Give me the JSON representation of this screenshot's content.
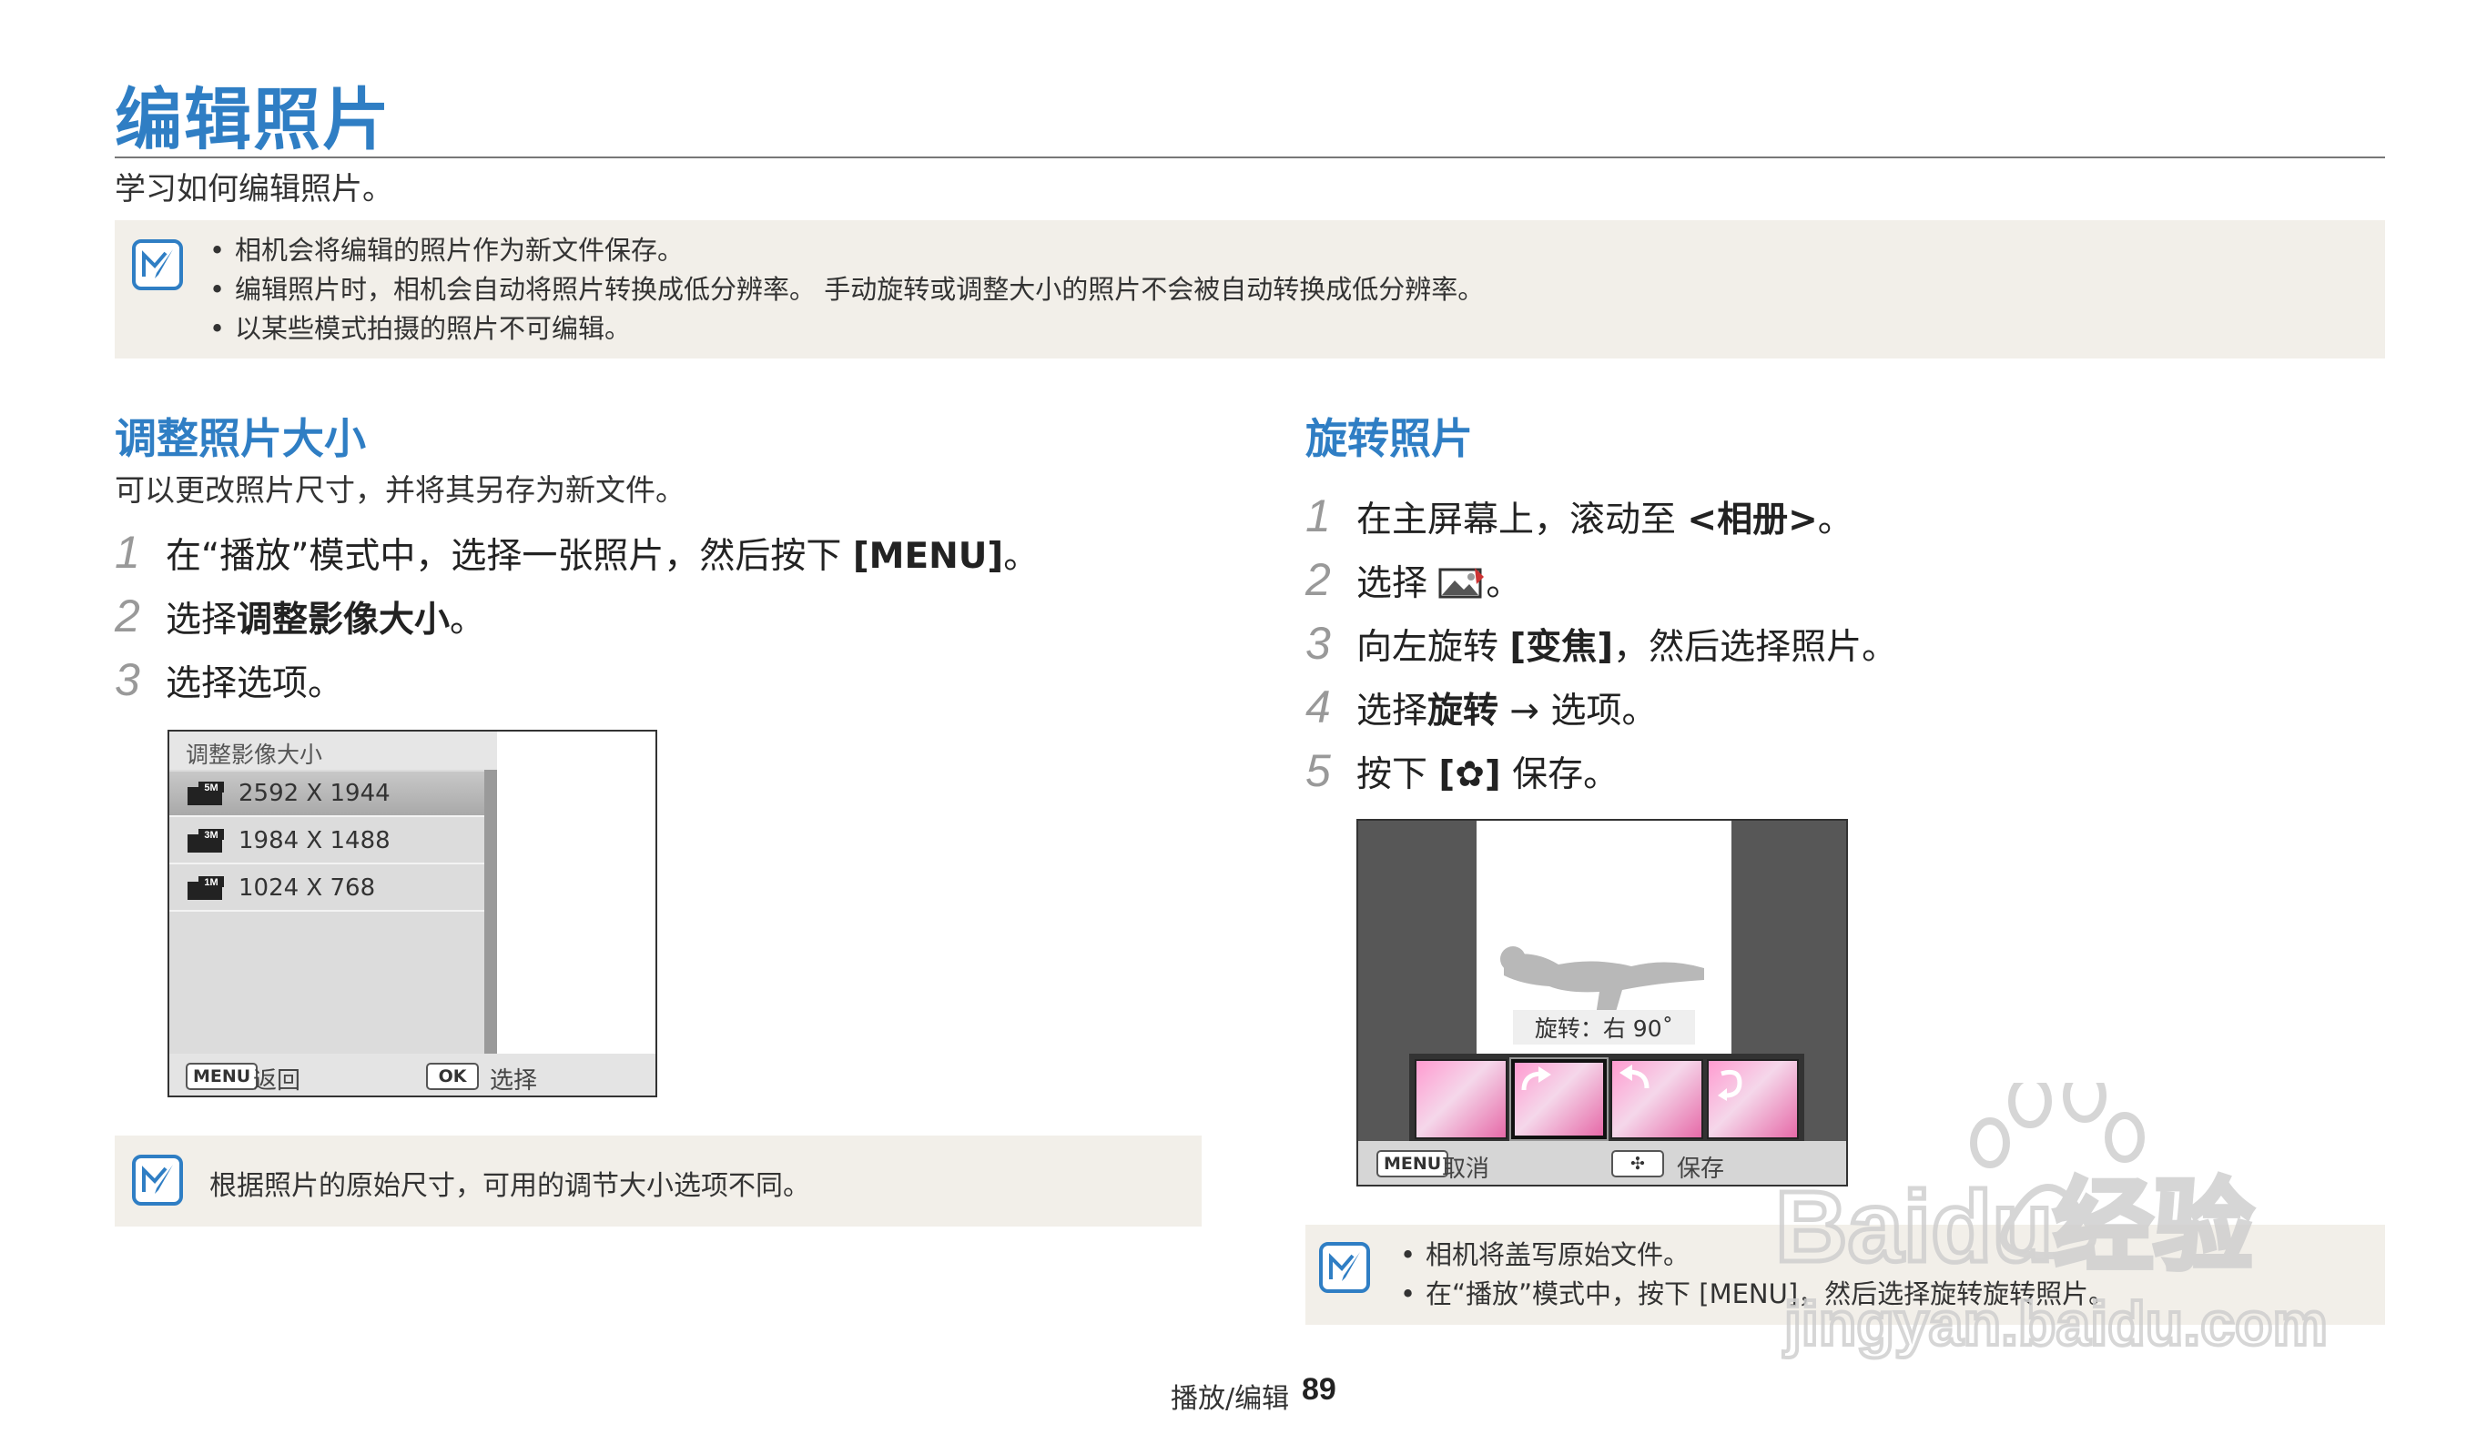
{
  "page": {
    "title": "编辑照片",
    "subtitle": "学习如何编辑照片。"
  },
  "top_note": {
    "icon": "note-pencil-icon",
    "items": [
      "相机会将编辑的照片作为新文件保存。",
      "编辑照片时，相机会自动将照片转换成低分辨率。 手动旋转或调整大小的照片不会被自动转换成低分辨率。",
      "以某些模式拍摄的照片不可编辑。"
    ]
  },
  "resize": {
    "title": "调整照片大小",
    "desc": "可以更改照片尺寸，并将其另存为新文件。",
    "steps": [
      {
        "num": "1",
        "pre": "在“播放”模式中，选择一张照片，然后按下 ",
        "bold": "[MENU]",
        "post": "。"
      },
      {
        "num": "2",
        "pre": "选择",
        "bold": "调整影像大小",
        "post": "。"
      },
      {
        "num": "3",
        "pre": "选择选项。",
        "bold": "",
        "post": ""
      }
    ],
    "screen": {
      "header": "调整影像大小",
      "options": [
        {
          "icon": "size-5m-icon",
          "icon_label": "5M",
          "label": "2592 X 1944"
        },
        {
          "icon": "size-3m-icon",
          "icon_label": "3M",
          "label": "1984 X 1488"
        },
        {
          "icon": "size-1m-icon",
          "icon_label": "1M",
          "label": "1024 X 768"
        }
      ],
      "footer_menu_tag": "MENU",
      "footer_menu_label": "返回",
      "footer_ok_tag": "OK",
      "footer_ok_label": "选择"
    },
    "note": "根据照片的原始尺寸，可用的调节大小选项不同。"
  },
  "rotate": {
    "title": "旋转照片",
    "steps": [
      {
        "num": "1",
        "pre": "在主屏幕上，滚动至 ",
        "bold": "<相册>",
        "post": "。"
      },
      {
        "num": "2",
        "pre": "选择 ",
        "bold": "",
        "post": "。"
      },
      {
        "num": "3",
        "pre": "向左旋转 ",
        "bold": "[变焦]",
        "post": "，然后选择照片。"
      },
      {
        "num": "4",
        "pre": "选择",
        "bold": "旋转",
        "post": " → 选项。"
      },
      {
        "num": "5",
        "pre": "按下 ",
        "bold": "[✿]",
        "post": " 保存。"
      }
    ],
    "screen": {
      "rotation_label": "旋转：右 90˚",
      "footer_menu_tag": "MENU",
      "footer_menu_label": "取消",
      "footer_save_label": "保存"
    },
    "note_items": [
      "相机将盖写原始文件。",
      "在“播放”模式中，按下 [MENU]，然后选择旋转旋转照片。"
    ]
  },
  "footer": {
    "section": "播放/编辑",
    "page_number": "89"
  },
  "watermark": {
    "brand": "Baidu经验",
    "url": "jingyan.baidu.com"
  }
}
